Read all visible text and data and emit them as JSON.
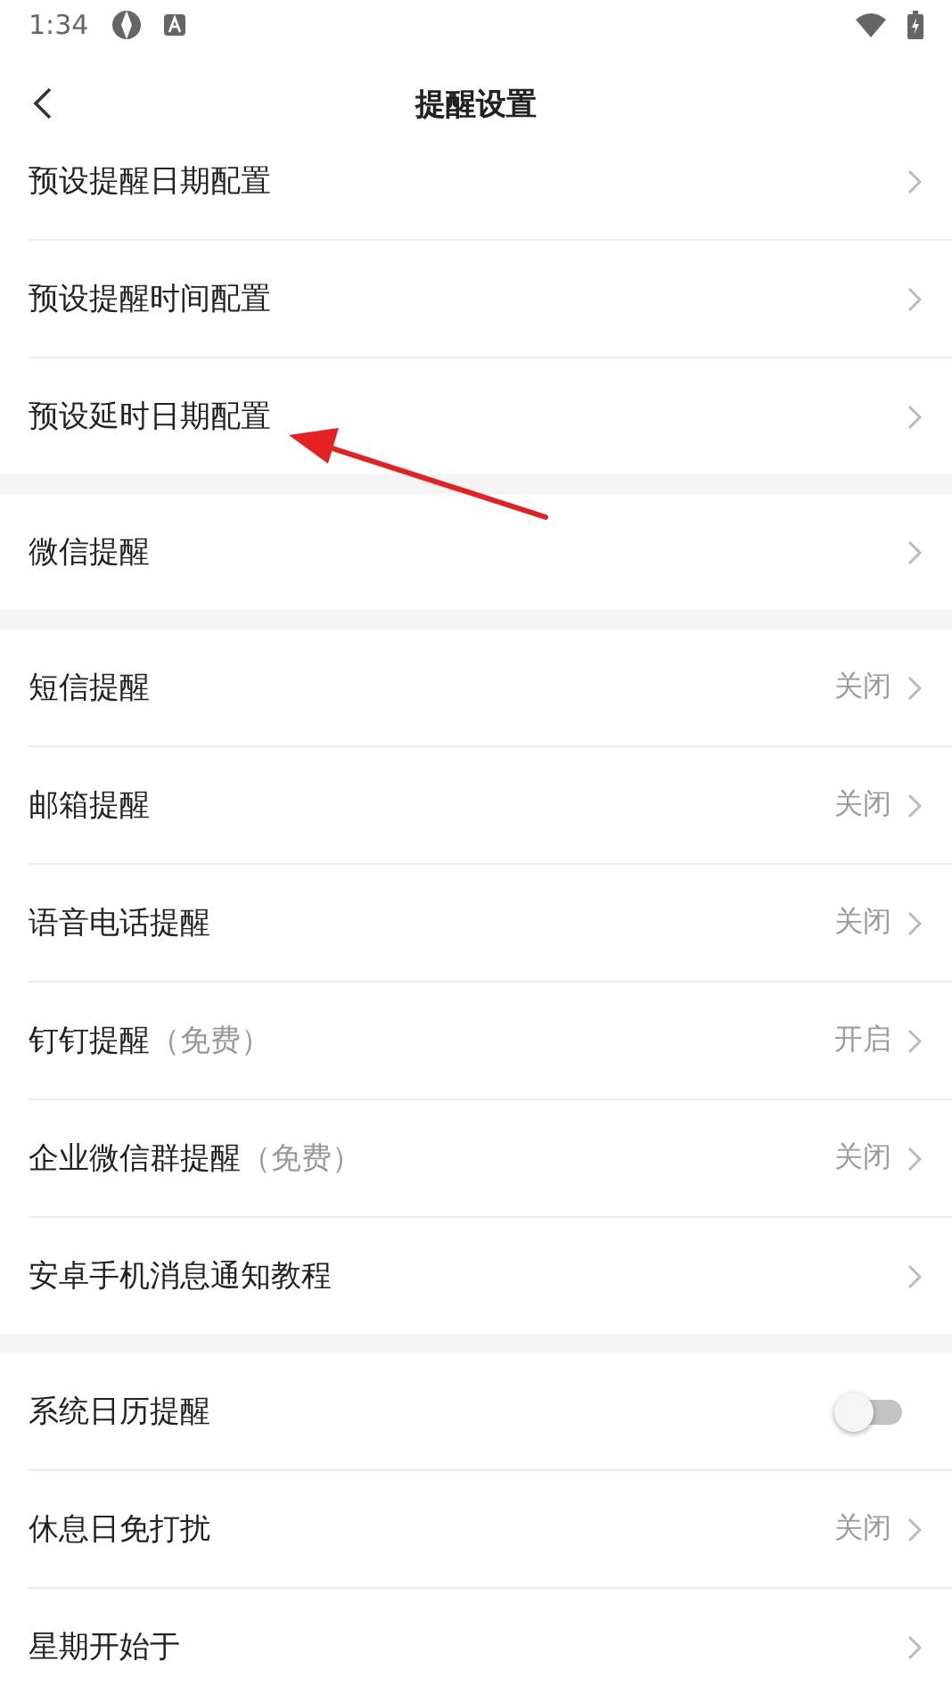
{
  "status_bar": {
    "time": "1:34"
  },
  "header": {
    "title": "提醒设置"
  },
  "groups": [
    {
      "rows": [
        {
          "kind": "link",
          "label": "预设提醒日期配置"
        },
        {
          "kind": "link",
          "label": "预设提醒时间配置"
        },
        {
          "kind": "link",
          "label": "预设延时日期配置"
        }
      ]
    },
    {
      "rows": [
        {
          "kind": "link",
          "label": "微信提醒"
        }
      ]
    },
    {
      "rows": [
        {
          "kind": "link",
          "label": "短信提醒",
          "value": "关闭"
        },
        {
          "kind": "link",
          "label": "邮箱提醒",
          "value": "关闭"
        },
        {
          "kind": "link",
          "label": "语音电话提醒",
          "value": "关闭"
        },
        {
          "kind": "link",
          "label": "钉钉提醒",
          "note": "（免费）",
          "value": "开启"
        },
        {
          "kind": "link",
          "label": "企业微信群提醒",
          "note": "（免费）",
          "value": "关闭"
        },
        {
          "kind": "link",
          "label": "安卓手机消息通知教程"
        }
      ]
    },
    {
      "rows": [
        {
          "kind": "toggle",
          "label": "系统日历提醒",
          "on": false
        },
        {
          "kind": "link",
          "label": "休息日免打扰",
          "value": "关闭"
        },
        {
          "kind": "link",
          "label": "星期开始于"
        }
      ]
    }
  ]
}
